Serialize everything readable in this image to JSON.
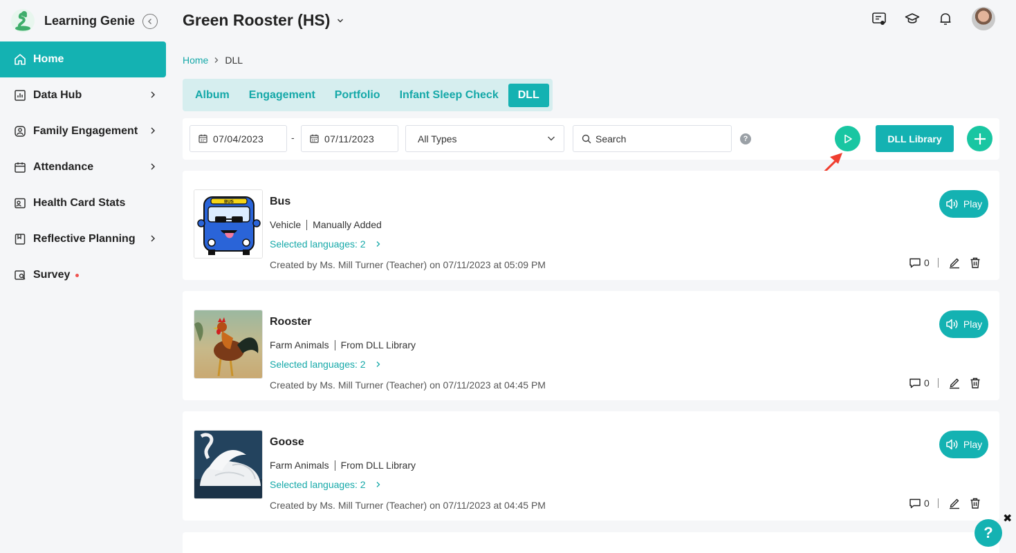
{
  "brand": {
    "name": "Learning Genie"
  },
  "sidebar": {
    "items": [
      {
        "label": "Home",
        "icon": "home-icon"
      },
      {
        "label": "Data Hub",
        "icon": "bar-chart-icon"
      },
      {
        "label": "Family Engagement",
        "icon": "family-icon"
      },
      {
        "label": "Attendance",
        "icon": "calendar-icon"
      },
      {
        "label": "Health Card Stats",
        "icon": "health-card-icon"
      },
      {
        "label": "Reflective Planning",
        "icon": "planning-icon"
      },
      {
        "label": "Survey",
        "icon": "survey-icon"
      }
    ]
  },
  "header": {
    "title": "Green Rooster (HS)"
  },
  "breadcrumb": {
    "home": "Home",
    "current": "DLL"
  },
  "tabs": [
    "Album",
    "Engagement",
    "Portfolio",
    "Infant Sleep Check",
    "DLL"
  ],
  "toolbar": {
    "start_date": "07/04/2023",
    "date_separator": "-",
    "end_date": "07/11/2023",
    "type_select": "All Types",
    "search_placeholder": "Search",
    "help": "?",
    "library_label": "DLL Library"
  },
  "cards": [
    {
      "title": "Bus",
      "category": "Vehicle",
      "source": "Manually Added",
      "languages": "Selected languages: 2",
      "created": "Created by Ms. Mill Turner (Teacher) on 07/11/2023 at 05:09 PM",
      "comments": "0",
      "play_label": "Play",
      "thumb_text": "BUS"
    },
    {
      "title": "Rooster",
      "category": "Farm Animals",
      "source": "From DLL Library",
      "languages": "Selected languages: 2",
      "created": "Created by Ms. Mill Turner (Teacher) on 07/11/2023 at 04:45 PM",
      "comments": "0",
      "play_label": "Play"
    },
    {
      "title": "Goose",
      "category": "Farm Animals",
      "source": "From DLL Library",
      "languages": "Selected languages: 2",
      "created": "Created by Ms. Mill Turner (Teacher) on 07/11/2023 at 04:45 PM",
      "comments": "0",
      "play_label": "Play"
    }
  ],
  "float_help": "?",
  "float_close": "✖",
  "colors": {
    "accent": "#14b2b2",
    "green": "#19c6a2",
    "annotation": "#f03e2f"
  }
}
